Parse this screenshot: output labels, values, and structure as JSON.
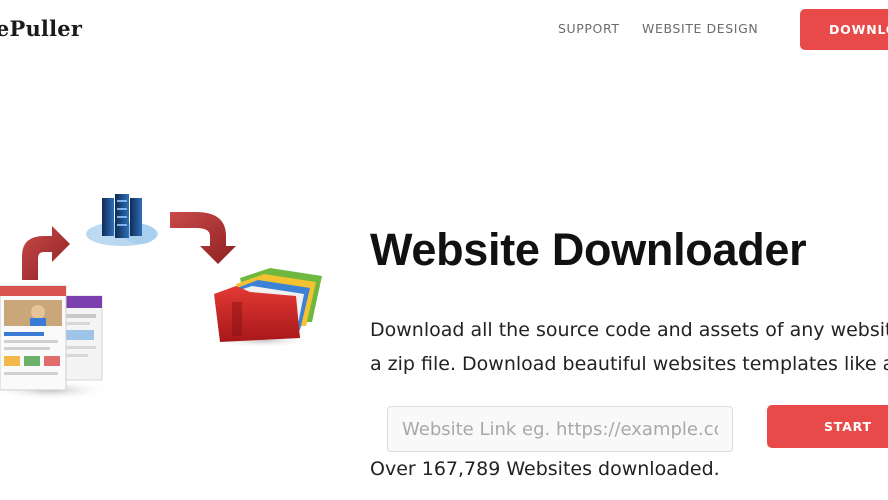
{
  "header": {
    "brand": "tePuller",
    "nav": {
      "support": "SUPPORT",
      "website_design": "WEBSITE DESIGN",
      "download": "DOWNLO"
    }
  },
  "hero": {
    "illustration_icons": [
      "browser-pages-icon",
      "up-arrow-icon",
      "server-cloud-icon",
      "down-arrow-icon",
      "folders-icon"
    ],
    "title": "Website Downloader",
    "description_line1": "Download all the source code and assets of any websit",
    "description_line2": "a zip file. Download beautiful websites templates like a",
    "input_placeholder": "Website Link eg. https://example.cc",
    "start_button": "START",
    "stats": "Over 167,789 Websites downloaded."
  },
  "colors": {
    "accent": "#e84a4a",
    "nav_text": "#6b6b6b",
    "text": "#1a1a1a"
  }
}
